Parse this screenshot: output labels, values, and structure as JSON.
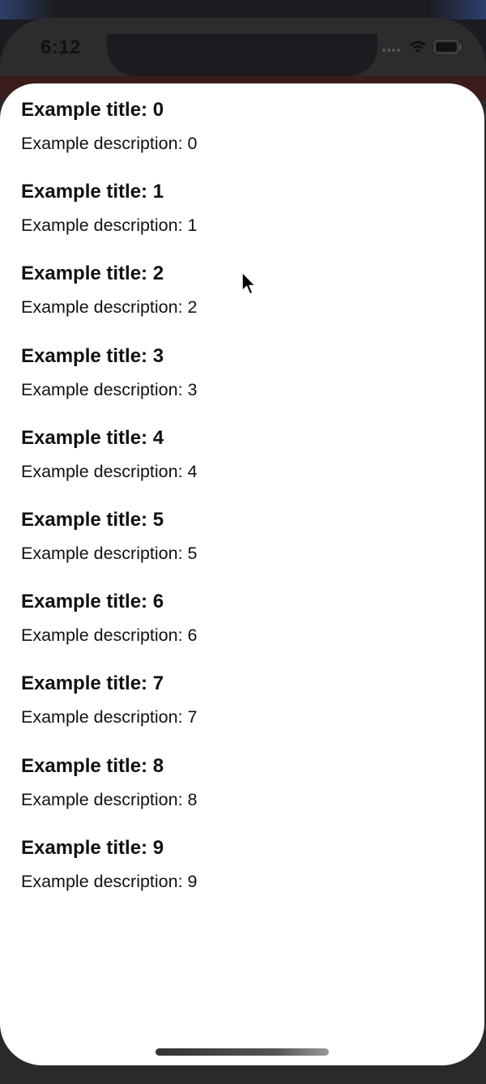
{
  "status_bar": {
    "time": "6:12"
  },
  "list": {
    "items": [
      {
        "title": "Example title: 0",
        "description": "Example description: 0"
      },
      {
        "title": "Example title: 1",
        "description": "Example description: 1"
      },
      {
        "title": "Example title: 2",
        "description": "Example description: 2"
      },
      {
        "title": "Example title: 3",
        "description": "Example description: 3"
      },
      {
        "title": "Example title: 4",
        "description": "Example description: 4"
      },
      {
        "title": "Example title: 5",
        "description": "Example description: 5"
      },
      {
        "title": "Example title: 6",
        "description": "Example description: 6"
      },
      {
        "title": "Example title: 7",
        "description": "Example description: 7"
      },
      {
        "title": "Example title: 8",
        "description": "Example description: 8"
      },
      {
        "title": "Example title: 9",
        "description": "Example description: 9"
      }
    ]
  },
  "icons": {
    "signal": "cellular-signal-icon",
    "wifi": "wifi-icon",
    "battery": "battery-icon",
    "cursor": "mouse-pointer-icon"
  },
  "colors": {
    "sheet_background": "#ffffff",
    "device_frame": "#1c1b1f",
    "text": "#111111"
  }
}
